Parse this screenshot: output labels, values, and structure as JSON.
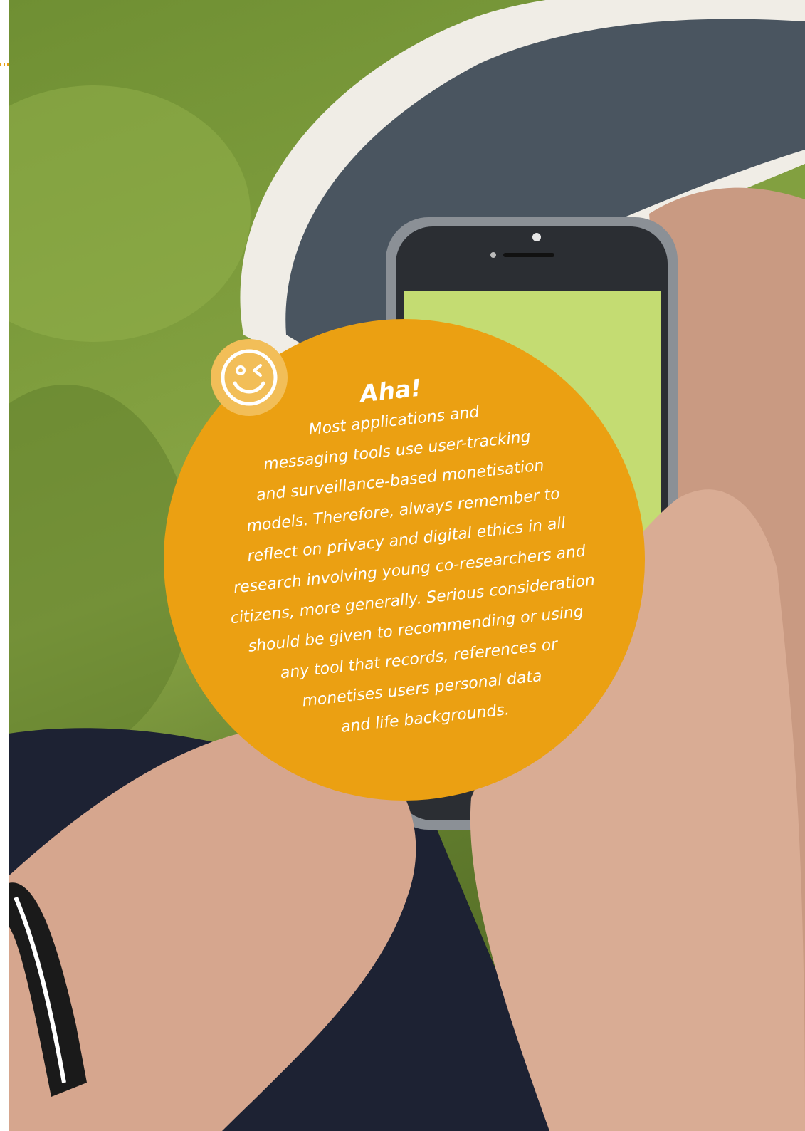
{
  "callout": {
    "title": "Aha!",
    "body": "Most applications and\nmessaging tools use user-tracking\nand surveillance-based monetisation\nmodels. Therefore, always remember to\nreflect on privacy and digital ethics in all\nresearch involving young co-researchers and\ncitizens, more generally. Serious consideration\nshould be given to recommending or using\nany tool that records, references or\nmonetises users personal data\nand life backgrounds."
  },
  "icons": {
    "badge": "winking-smiley-icon"
  },
  "colors": {
    "accent": "#eba012",
    "badge": "#f2be58",
    "text": "#ffffff"
  }
}
